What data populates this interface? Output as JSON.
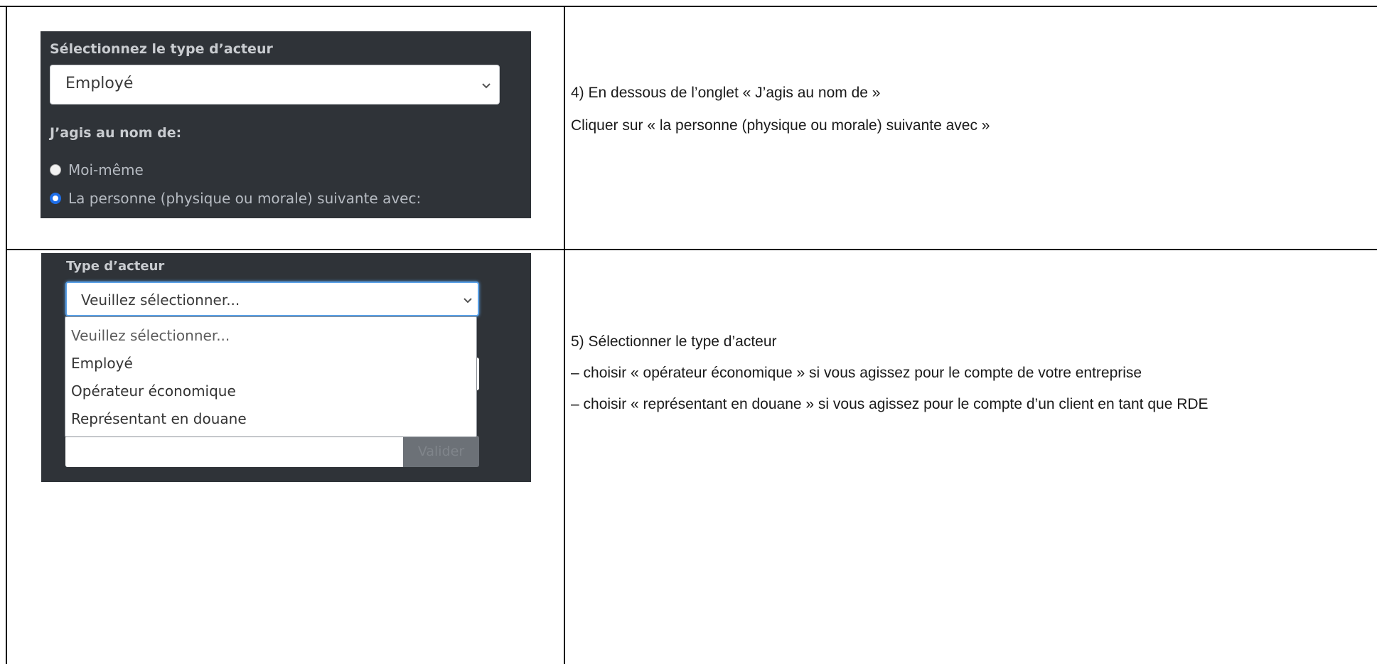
{
  "row1": {
    "actor_select_title": "Sélectionnez le type d’acteur",
    "actor_select_value": "Employé",
    "acting_title": "J’agis au nom de:",
    "radio_options": [
      {
        "label": "Moi-même",
        "checked": false
      },
      {
        "label": "La personne (physique ou morale) suivante avec:",
        "checked": true
      }
    ],
    "instructions": [
      "4) En dessous de l’onglet « J’agis au nom de »",
      "Cliquer sur « la personne (physique ou morale) suivante avec »"
    ]
  },
  "row2": {
    "type_title": "Type d’acteur",
    "select_value": "Veuillez sélectionner...",
    "dropdown_options": [
      "Veuillez sélectionner...",
      "Employé",
      "Opérateur économique",
      "Représentant en douane"
    ],
    "validate_label": "Valider",
    "instructions": [
      "5) Sélectionner le type d’acteur",
      "– choisir « opérateur économique » si vous agissez pour le compte de votre entreprise",
      "– choisir « représentant en douane » si vous agissez pour le compte d’un client en tant que RDE"
    ]
  },
  "colors": {
    "panel_bg": "#2f3338",
    "radio_selected": "#1e6ee8",
    "focus_border": "#5aa0e6"
  },
  "icons": [
    "chevron-down-icon"
  ]
}
